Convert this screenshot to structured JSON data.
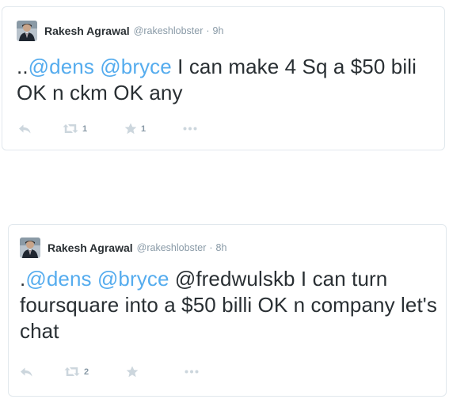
{
  "colors": {
    "mention": "#55acee",
    "text": "#292f33",
    "muted": "#8899a6",
    "icon": "#ccd6dd",
    "border": "#e1e8ed"
  },
  "tweets": [
    {
      "display_name": "Rakesh Agrawal",
      "handle": "@rakeshlobster",
      "separator": "·",
      "time": "9h",
      "text_prefix": "..",
      "mention1": "@dens",
      "mention2": "@bryce",
      "text": " I can make 4 Sq a $50 bili OK n ckm OK any",
      "retweets": "1",
      "favorites": "1"
    },
    {
      "display_name": "Rakesh Agrawal",
      "handle": "@rakeshlobster",
      "separator": "·",
      "time": "8h",
      "text_prefix": ".",
      "mention1": "@dens",
      "mention2": "@bryce",
      "text": " @fredwulskb I can turn foursquare into a $50 billi OK n company let's chat",
      "retweets": "2"
    }
  ]
}
